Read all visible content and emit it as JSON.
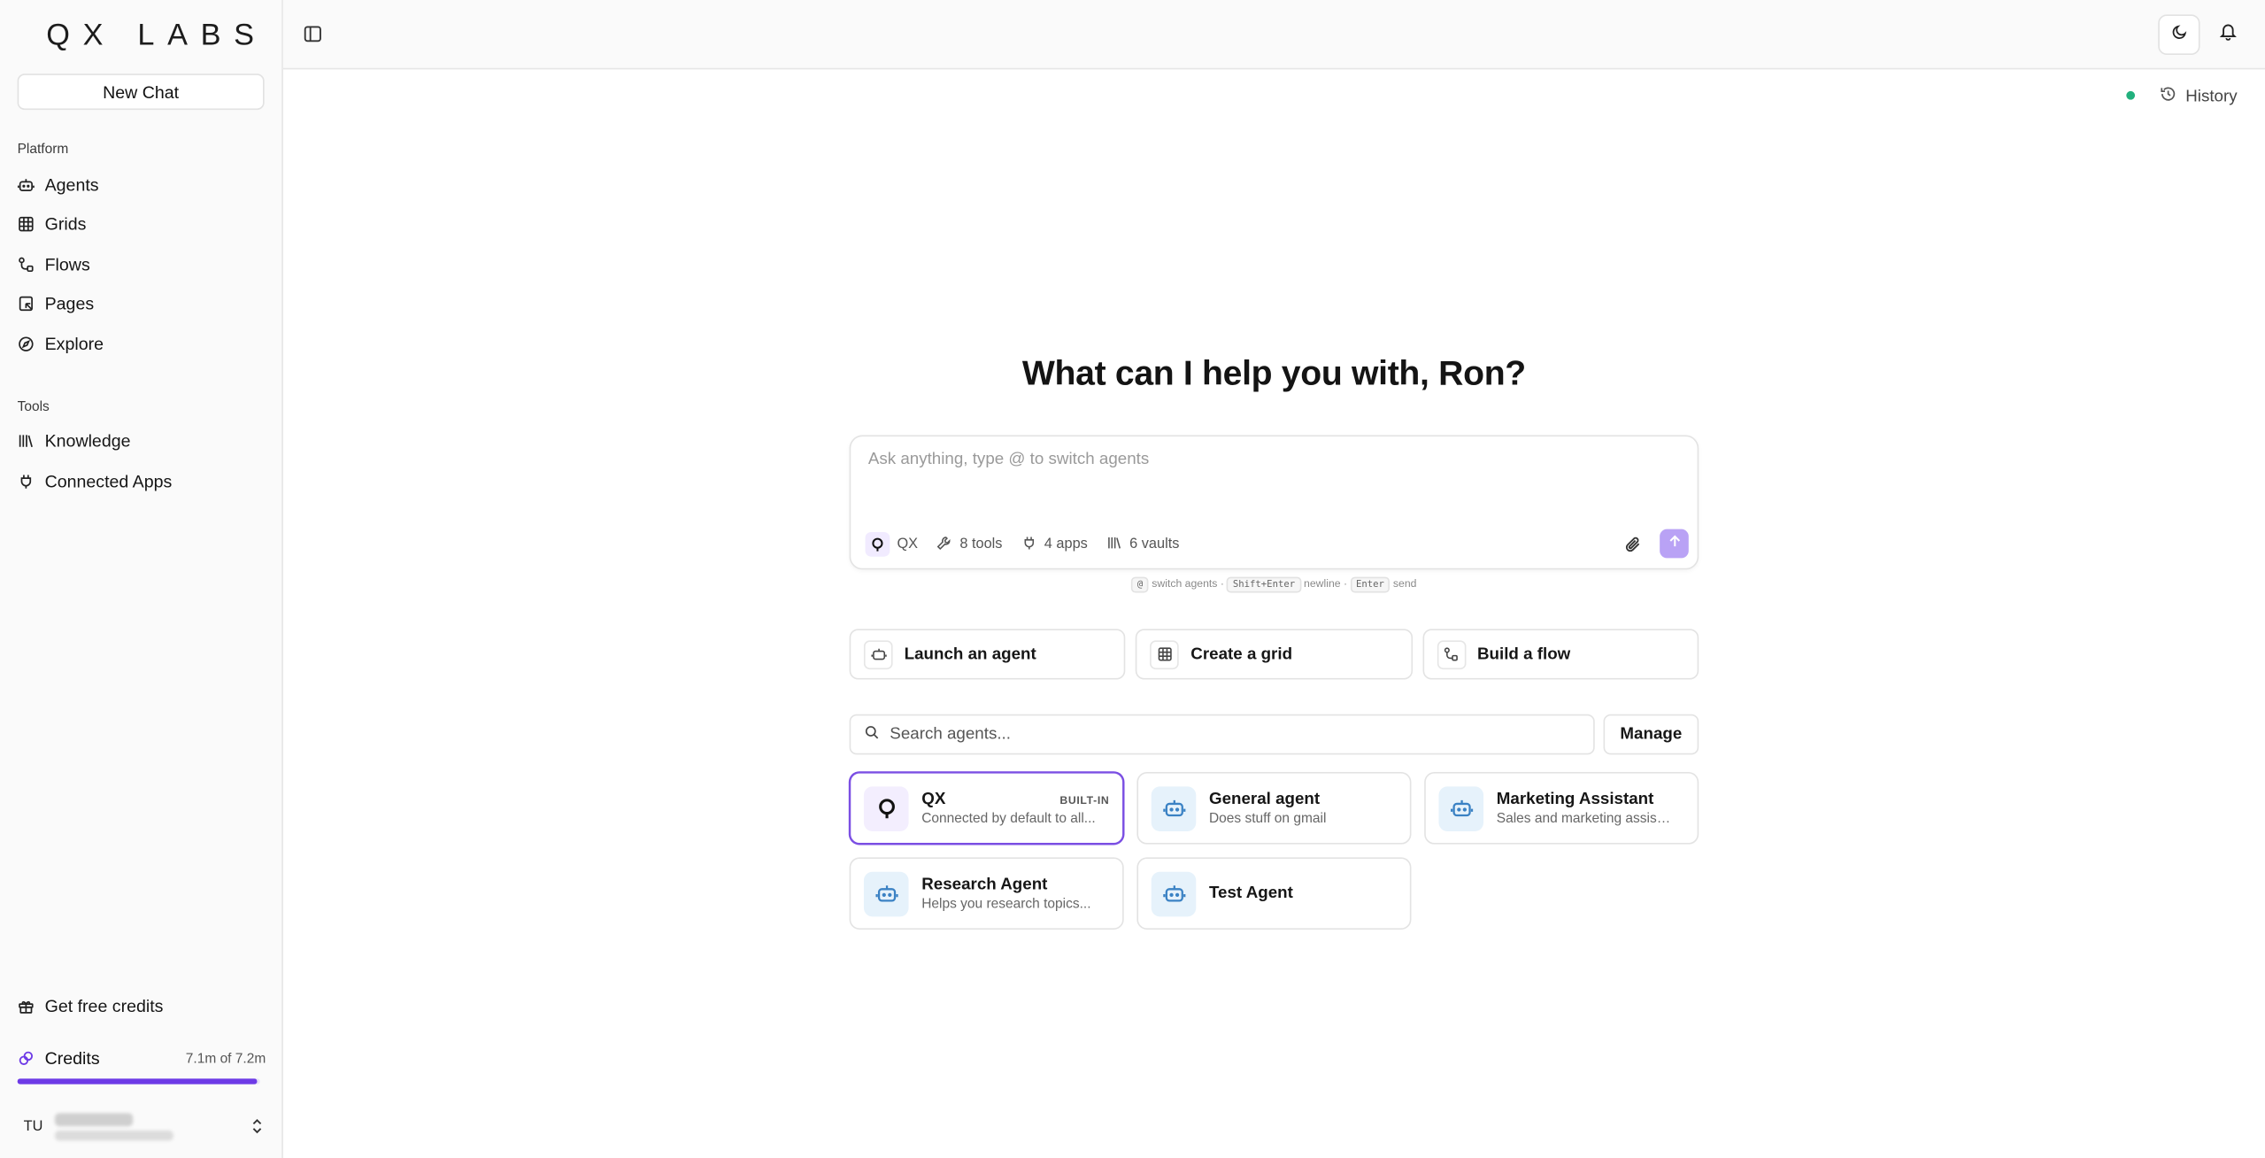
{
  "brand": {
    "logo": "QX LABS"
  },
  "sidebar": {
    "new_chat": "New Chat",
    "platform_label": "Platform",
    "platform_items": [
      {
        "label": "Agents",
        "icon": "robot-icon"
      },
      {
        "label": "Grids",
        "icon": "grid-icon"
      },
      {
        "label": "Flows",
        "icon": "flow-icon"
      },
      {
        "label": "Pages",
        "icon": "page-icon"
      },
      {
        "label": "Explore",
        "icon": "compass-icon"
      }
    ],
    "tools_label": "Tools",
    "tools_items": [
      {
        "label": "Knowledge",
        "icon": "library-icon"
      },
      {
        "label": "Connected Apps",
        "icon": "plug-icon"
      }
    ],
    "free_credits": "Get free credits",
    "credits": {
      "label": "Credits",
      "amount": "7.1m of 7.2m",
      "fraction": 0.986
    },
    "user": {
      "initials": "TU"
    }
  },
  "topbar": {
    "theme_icon": "moon-icon",
    "notifications_icon": "bell-icon"
  },
  "main": {
    "history": "History",
    "status_color": "#22b07d",
    "headline": "What can I help you with, Ron?",
    "composer": {
      "placeholder": "Ask anything, type @ to switch agents",
      "agent": "QX",
      "tools": "8 tools",
      "apps": "4 apps",
      "vaults": "6 vaults"
    },
    "hint": {
      "at": "@",
      "switch": "switch agents ·",
      "shift_enter": "Shift+Enter",
      "newline": "newline ·",
      "enter": "Enter",
      "send": "send"
    },
    "quick_actions": [
      {
        "label": "Launch an agent",
        "icon": "robot-icon"
      },
      {
        "label": "Create a grid",
        "icon": "grid-icon"
      },
      {
        "label": "Build a flow",
        "icon": "flow-icon"
      }
    ],
    "search": {
      "placeholder": "Search agents..."
    },
    "manage": "Manage",
    "agents": [
      {
        "name": "QX",
        "desc": "Connected by default to all...",
        "badge": "BUILT-IN",
        "selected": true
      },
      {
        "name": "General agent",
        "desc": "Does stuff on gmail"
      },
      {
        "name": "Marketing Assistant",
        "desc": "Sales and marketing assistant"
      },
      {
        "name": "Research Agent",
        "desc": "Helps you research topics..."
      },
      {
        "name": "Test Agent",
        "desc": ""
      }
    ]
  },
  "colors": {
    "accent": "#6d3ae6",
    "send": "#b9a2f5",
    "agent_icon_bg": "#e6f2fb"
  }
}
